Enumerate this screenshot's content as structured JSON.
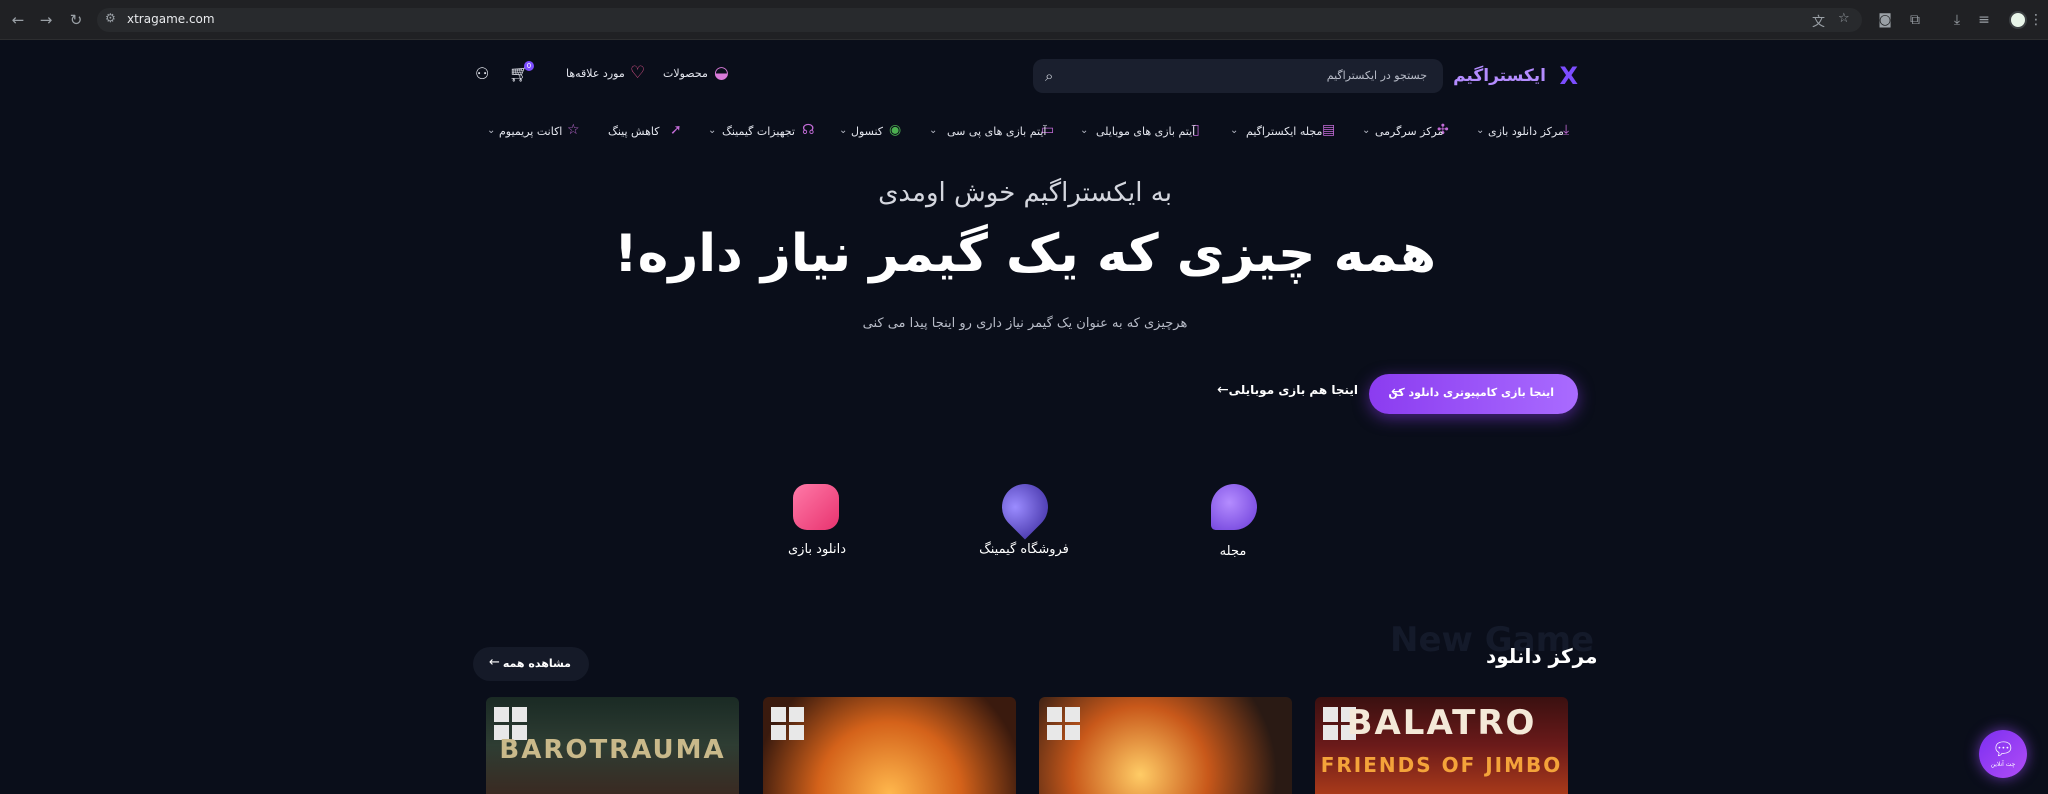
{
  "browser": {
    "url": "xtragame.com",
    "profile_color": "#e8f5e9"
  },
  "header": {
    "logo_mark": "X",
    "logo_text": "ایکستراگیم",
    "search_placeholder": "جستجو در ایکستراگیم",
    "products_label": "محصولات",
    "wishlist_label": "مورد علاقه‌ها",
    "cart_count": "0"
  },
  "menu": [
    {
      "label": "مرکز دانلود بازی",
      "icon": "download-icon"
    },
    {
      "label": "مرکز سرگرمی",
      "icon": "puzzle-icon"
    },
    {
      "label": "مجله ایکستراگیم",
      "icon": "magazine-icon"
    },
    {
      "label": "آیتم بازی های موبایلی",
      "icon": "mobile-icon"
    },
    {
      "label": "آیتم بازی های پی سی",
      "icon": "pc-icon"
    },
    {
      "label": "کنسول",
      "icon": "xbox-icon"
    },
    {
      "label": "تجهیزات گیمینگ",
      "icon": "headset-icon"
    },
    {
      "label": "کاهش پینگ",
      "icon": "rocket-icon"
    },
    {
      "label": "اکانت پریمیوم",
      "icon": "star-icon"
    }
  ],
  "hero": {
    "welcome": "به ایکستراگیم خوش اومدی",
    "headline": "همه چیزی که یک گیمر نیاز داره!",
    "subtitle": "هرچیزی که به عنوان یک گیمر نیاز داری رو اینجا پیدا می کنی",
    "cta_primary": "اینجا بازی کامپیوتری دانلود کن",
    "cta_secondary": "اینجا هم بازی موبایلی"
  },
  "features": [
    {
      "label": "مجله",
      "icon": "chat-bubble-icon",
      "color": "#8a5cf6"
    },
    {
      "label": "فروشگاه گیمینگ",
      "icon": "location-pin-icon",
      "color": "#6b4cf0"
    },
    {
      "label": "دانلود بازی",
      "icon": "gamepad-icon",
      "color": "#ff4f8b"
    }
  ],
  "section": {
    "ghost_text": "New Game",
    "title": "مرکز دانلود",
    "see_all": "مشاهده همه"
  },
  "games": [
    {
      "title": "BALATRO",
      "subtitle": "FRIENDS OF JIMBO",
      "platform": "windows-icon"
    },
    {
      "title": "",
      "subtitle": "",
      "platform": "windows-icon"
    },
    {
      "title": "",
      "subtitle": "",
      "platform": "windows-icon"
    },
    {
      "title": "BAROTRAUMA",
      "subtitle": "",
      "platform": "windows-icon"
    }
  ],
  "chat": {
    "label": "چت آنلاین"
  },
  "colors": {
    "accent": "#8b3cf0",
    "background": "#0a0e1a"
  }
}
